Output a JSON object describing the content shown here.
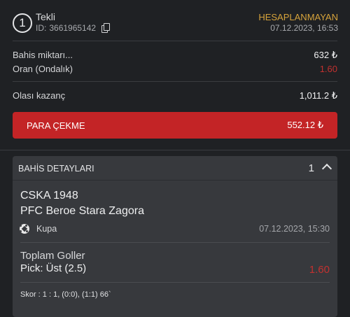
{
  "header": {
    "badge_number": "1",
    "bet_type": "Tekli",
    "id_label": "ID:",
    "id_value": "3661965142",
    "status": "HESAPLANMAYAN",
    "status_date": "07.12.2023, 16:53"
  },
  "summary": {
    "stake_label": "Bahis miktarı...",
    "stake_value": "632 ₺",
    "odds_label": "Oran (Ondalık)",
    "odds_value": "1.60",
    "potential_label": "Olası kazanç",
    "potential_value": "1,011.2 ₺"
  },
  "cashout": {
    "label": "PARA ÇEKME",
    "amount": "552.12 ₺"
  },
  "details": {
    "title": "BAHİS DETAYLARI",
    "count": "1",
    "team_home": "CSKA 1948",
    "team_away": "PFC Beroe Stara Zagora",
    "league": "Kupa",
    "match_date": "07.12.2023, 15:30",
    "market": "Toplam Goller",
    "pick": "Pick: Üst (2.5)",
    "pick_odds": "1.60",
    "score": "Skor : 1 : 1, (0:0), (1:1) 66`"
  },
  "colors": {
    "background": "#1f2124",
    "status": "#d6a33b",
    "accent_red": "#c32426",
    "odds_red": "#c2312f",
    "panel": "#37393d"
  },
  "icons": [
    "number-badge-icon",
    "copy-icon",
    "chevron-up-icon",
    "soccer-ball-icon"
  ]
}
